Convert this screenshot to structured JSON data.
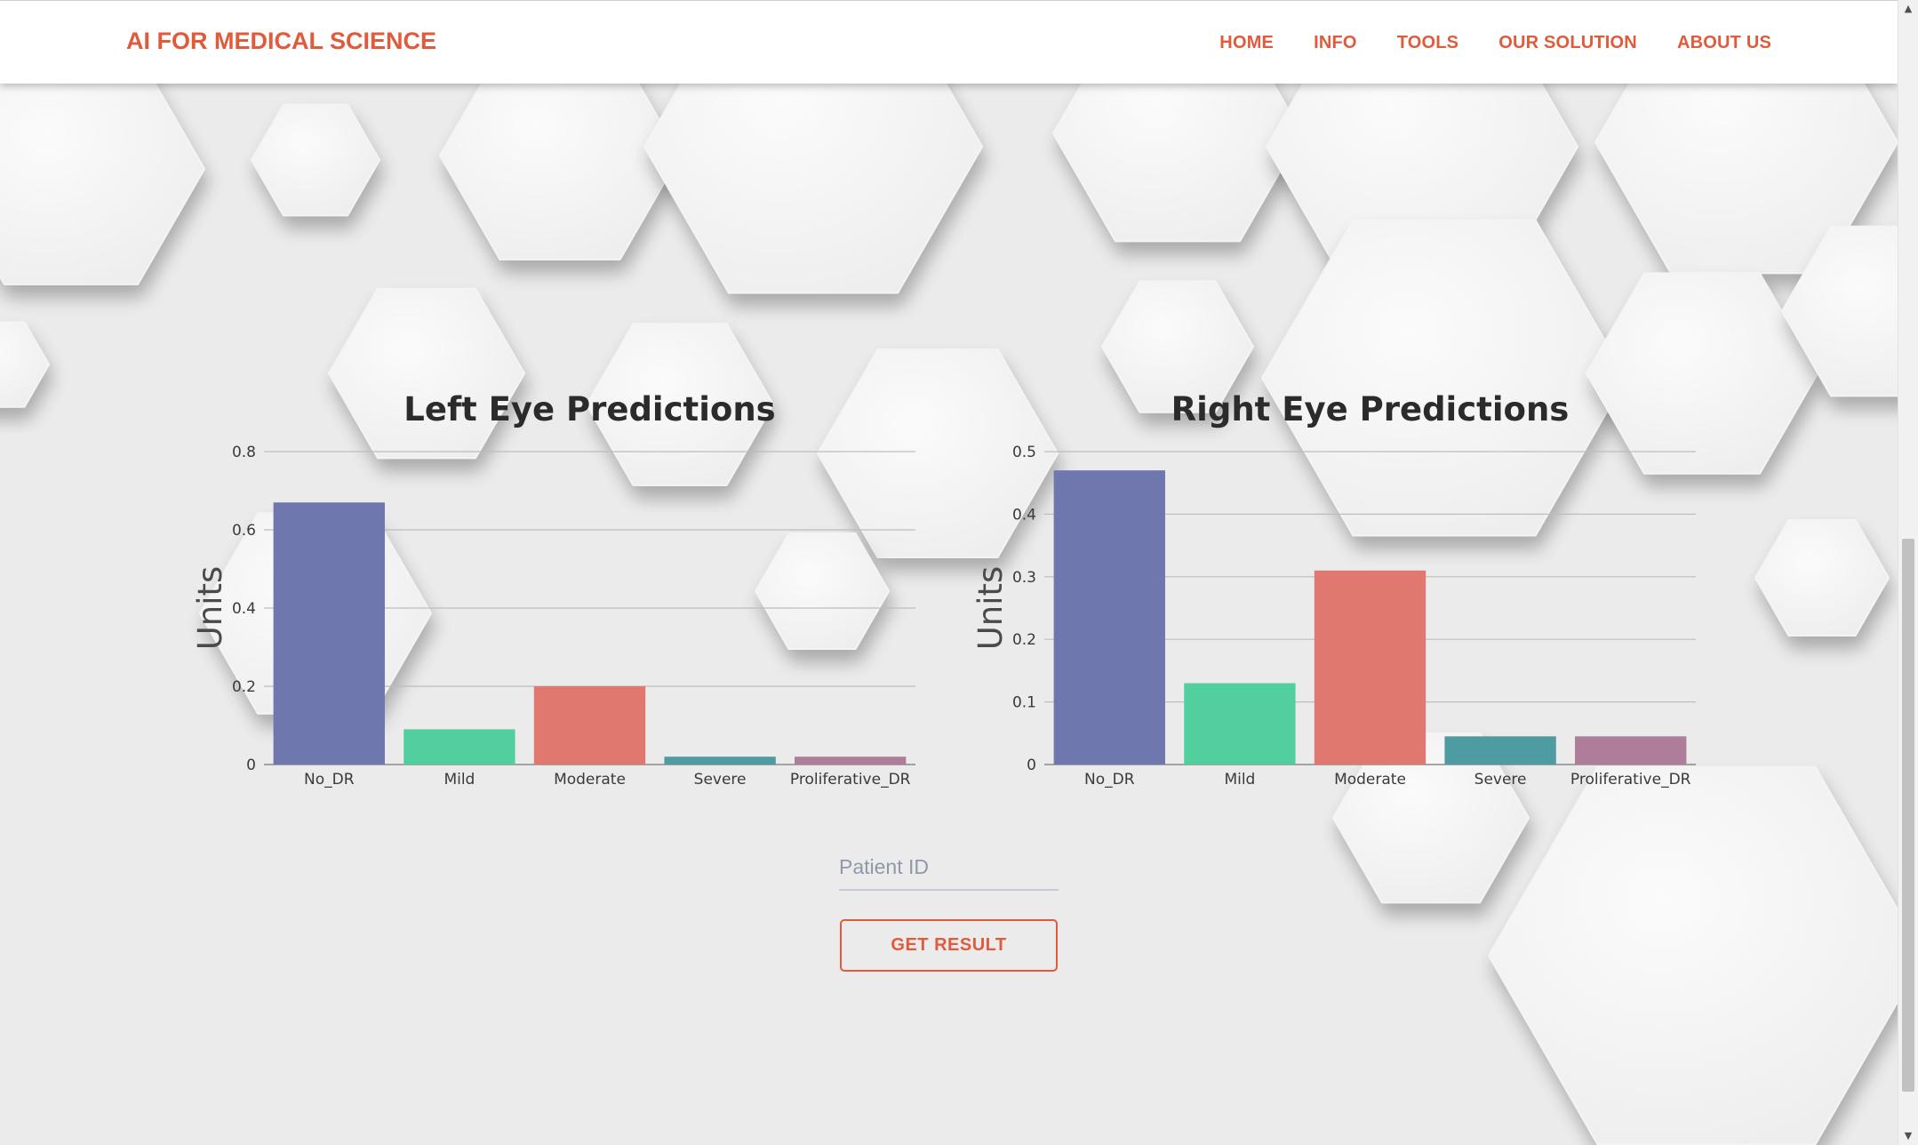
{
  "nav": {
    "brand": "AI FOR MEDICAL SCIENCE",
    "links": [
      "HOME",
      "INFO",
      "TOOLS",
      "OUR SOLUTION",
      "ABOUT US"
    ]
  },
  "colors": {
    "accent": "#e05a3c",
    "series": [
      "#6e78ae",
      "#52cf9e",
      "#e07870",
      "#4e9ba1",
      "#ad7d9a"
    ]
  },
  "form": {
    "patient_id_placeholder": "Patient ID",
    "submit_label": "GET RESULT"
  },
  "chart_data": [
    {
      "type": "bar",
      "title": "Left Eye Predictions",
      "xlabel": "",
      "ylabel": "Units",
      "categories": [
        "No_DR",
        "Mild",
        "Moderate",
        "Severe",
        "Proliferative_DR"
      ],
      "values": [
        0.67,
        0.09,
        0.2,
        0.02,
        0.02
      ],
      "ylim": [
        0,
        0.8
      ],
      "yticks": [
        0,
        0.2,
        0.4,
        0.6,
        0.8
      ],
      "ytick_labels": [
        "0",
        "0.2",
        "0.4",
        "0.6",
        "0.8"
      ],
      "grid": true
    },
    {
      "type": "bar",
      "title": "Right Eye Predictions",
      "xlabel": "",
      "ylabel": "Units",
      "categories": [
        "No_DR",
        "Mild",
        "Moderate",
        "Severe",
        "Proliferative_DR"
      ],
      "values": [
        0.47,
        0.13,
        0.31,
        0.045,
        0.045
      ],
      "ylim": [
        0,
        0.5
      ],
      "yticks": [
        0,
        0.1,
        0.2,
        0.3,
        0.4,
        0.5
      ],
      "ytick_labels": [
        "0",
        "0.1",
        "0.2",
        "0.3",
        "0.4",
        "0.5"
      ],
      "grid": true
    }
  ]
}
